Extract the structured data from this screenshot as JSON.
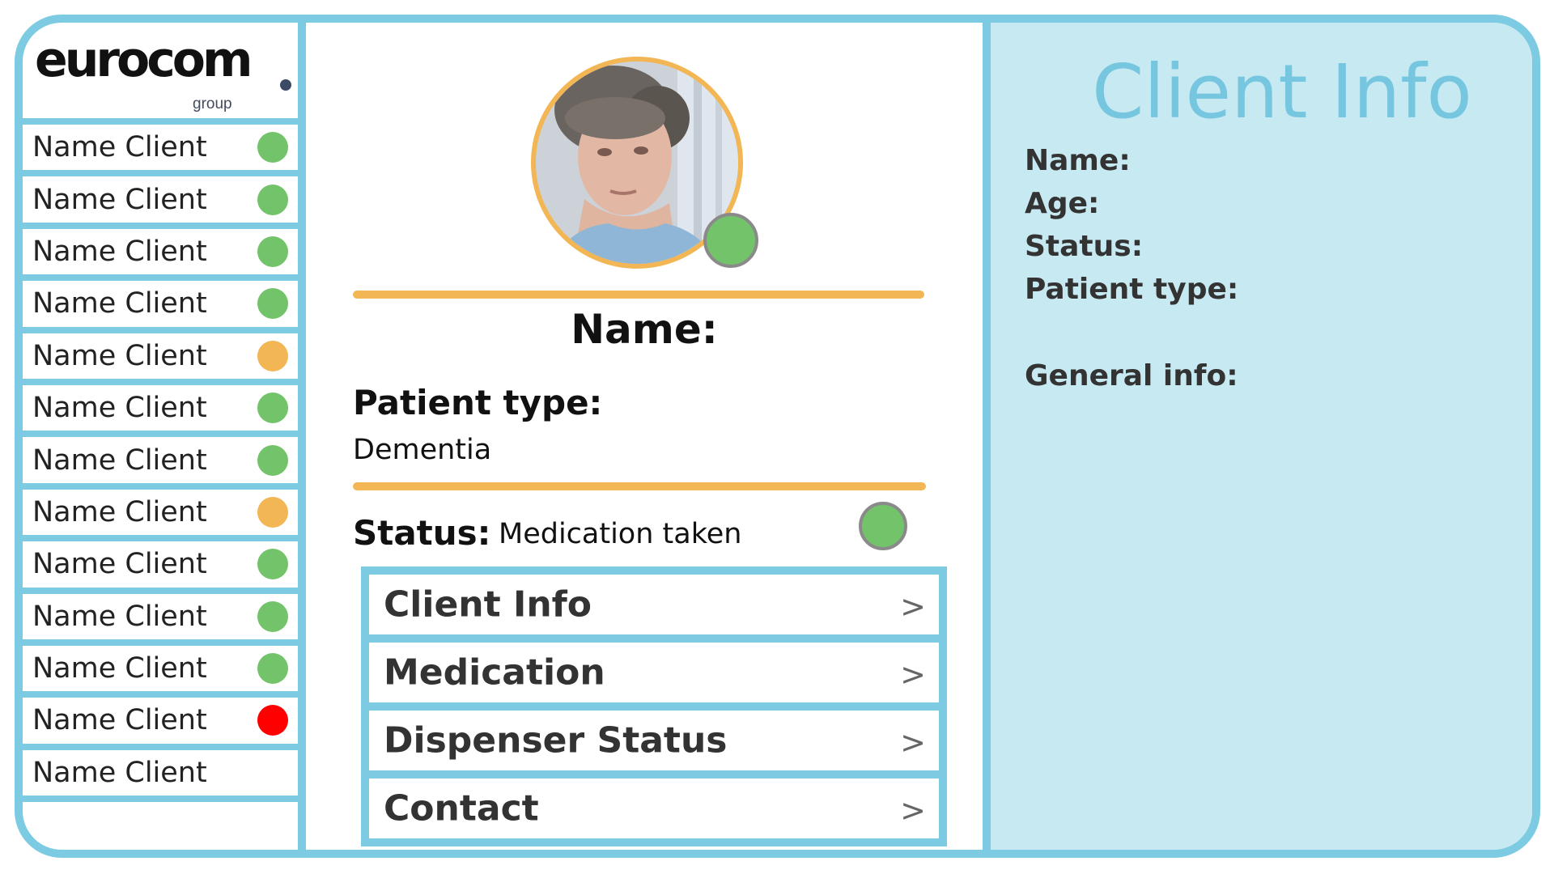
{
  "brand": {
    "logo_word": "eurocom",
    "logo_subtext": "group",
    "logo_dot_color": "#3d4a66"
  },
  "sidebar": {
    "clients": [
      {
        "name": "Name Client",
        "status": "green"
      },
      {
        "name": "Name Client",
        "status": "green"
      },
      {
        "name": "Name Client",
        "status": "green"
      },
      {
        "name": "Name Client",
        "status": "green"
      },
      {
        "name": "Name Client",
        "status": "orange"
      },
      {
        "name": "Name Client",
        "status": "green"
      },
      {
        "name": "Name Client",
        "status": "green"
      },
      {
        "name": "Name Client",
        "status": "orange"
      },
      {
        "name": "Name Client",
        "status": "green"
      },
      {
        "name": "Name Client",
        "status": "green"
      },
      {
        "name": "Name Client",
        "status": "green"
      },
      {
        "name": "Name Client",
        "status": "red"
      },
      {
        "name": "Name Client",
        "status": "none"
      }
    ]
  },
  "colors": {
    "green": "#73c36b",
    "orange": "#f3b654",
    "red": "#ff0000",
    "accent_blue": "#7ccbe2",
    "panel_bg": "#c7e9f2"
  },
  "profile": {
    "avatar_status": "green",
    "name_label": "Name:",
    "patient_type_label": "Patient type:",
    "patient_type_value": "Dementia",
    "status_label": "Status:",
    "status_value": "Medication taken",
    "status_color": "green"
  },
  "menu": [
    {
      "label": "Client Info",
      "chevron": ">"
    },
    {
      "label": "Medication",
      "chevron": ">"
    },
    {
      "label": "Dispenser Status",
      "chevron": ">"
    },
    {
      "label": "Contact",
      "chevron": ">"
    }
  ],
  "info_panel": {
    "title": "Client Info",
    "name_label": "Name:",
    "age_label": "Age:",
    "status_label": "Status:",
    "patient_type_label": "Patient type:",
    "general_info_label": "General info:"
  }
}
